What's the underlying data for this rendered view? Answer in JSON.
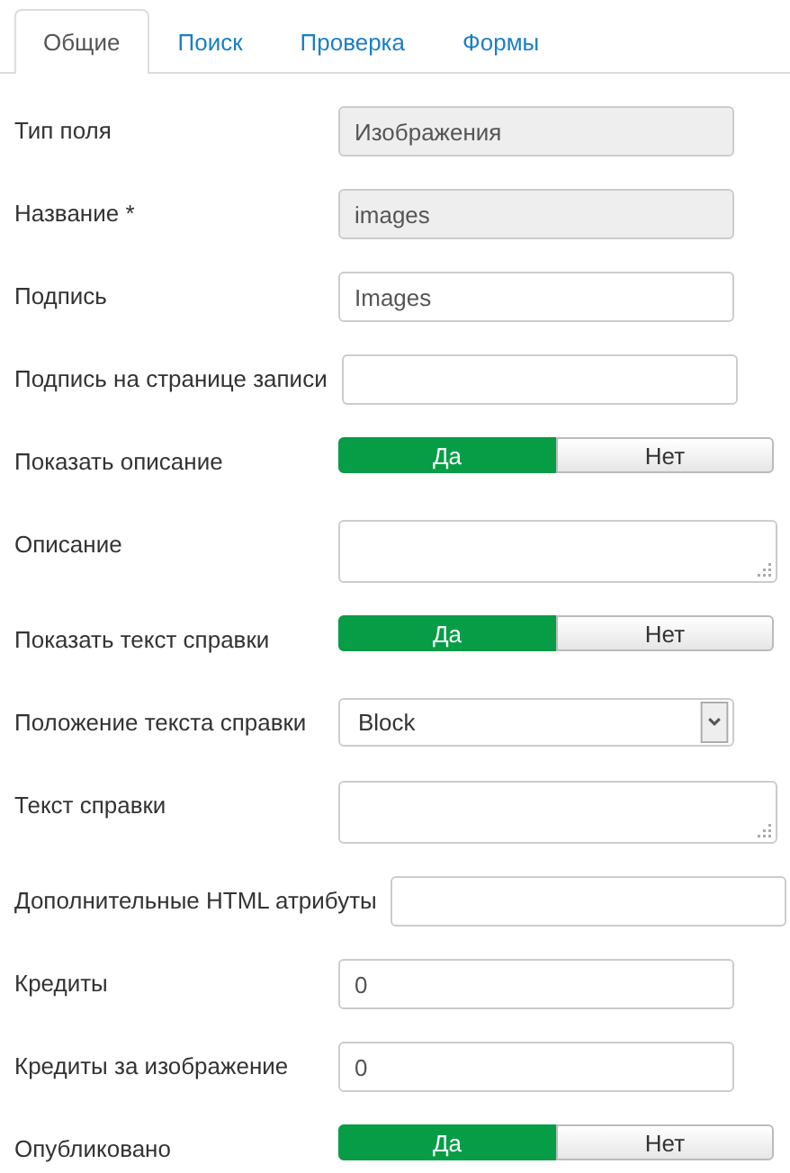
{
  "tabs": [
    {
      "label": "Общие",
      "selected": true
    },
    {
      "label": "Поиск",
      "selected": false
    },
    {
      "label": "Проверка",
      "selected": false
    },
    {
      "label": "Формы",
      "selected": false
    }
  ],
  "fields": [
    {
      "kind": "text",
      "label": "Тип поля",
      "value": "Изображения",
      "readonly": true
    },
    {
      "kind": "text",
      "label": "Название *",
      "value": "images",
      "readonly": true
    },
    {
      "kind": "text",
      "label": "Подпись",
      "value": "Images",
      "readonly": false
    },
    {
      "kind": "text",
      "label": "Подпись на странице записи",
      "readonly": false
    },
    {
      "kind": "toggle",
      "label": "Показать описание",
      "options": [
        {
          "label": "Да",
          "selected": true
        },
        {
          "label": "Нет",
          "selected": false
        }
      ]
    },
    {
      "kind": "textarea",
      "label": "Описание"
    },
    {
      "kind": "toggle",
      "label": "Показать текст справки",
      "options": [
        {
          "label": "Да",
          "selected": true
        },
        {
          "label": "Нет",
          "selected": false
        }
      ]
    },
    {
      "kind": "select",
      "label": "Положение текста справки",
      "value": "Block"
    },
    {
      "kind": "textarea",
      "label": "Текст справки"
    },
    {
      "kind": "text",
      "label": "Дополнительные HTML атрибуты",
      "readonly": false
    },
    {
      "kind": "text",
      "label": "Кредиты",
      "value": "0",
      "readonly": false
    },
    {
      "kind": "text",
      "label": "Кредиты за изображение",
      "value": "0",
      "readonly": false
    },
    {
      "kind": "toggle",
      "label": "Опубликовано",
      "options": [
        {
          "label": "Да",
          "selected": true
        },
        {
          "label": "Нет",
          "selected": false
        }
      ]
    }
  ]
}
